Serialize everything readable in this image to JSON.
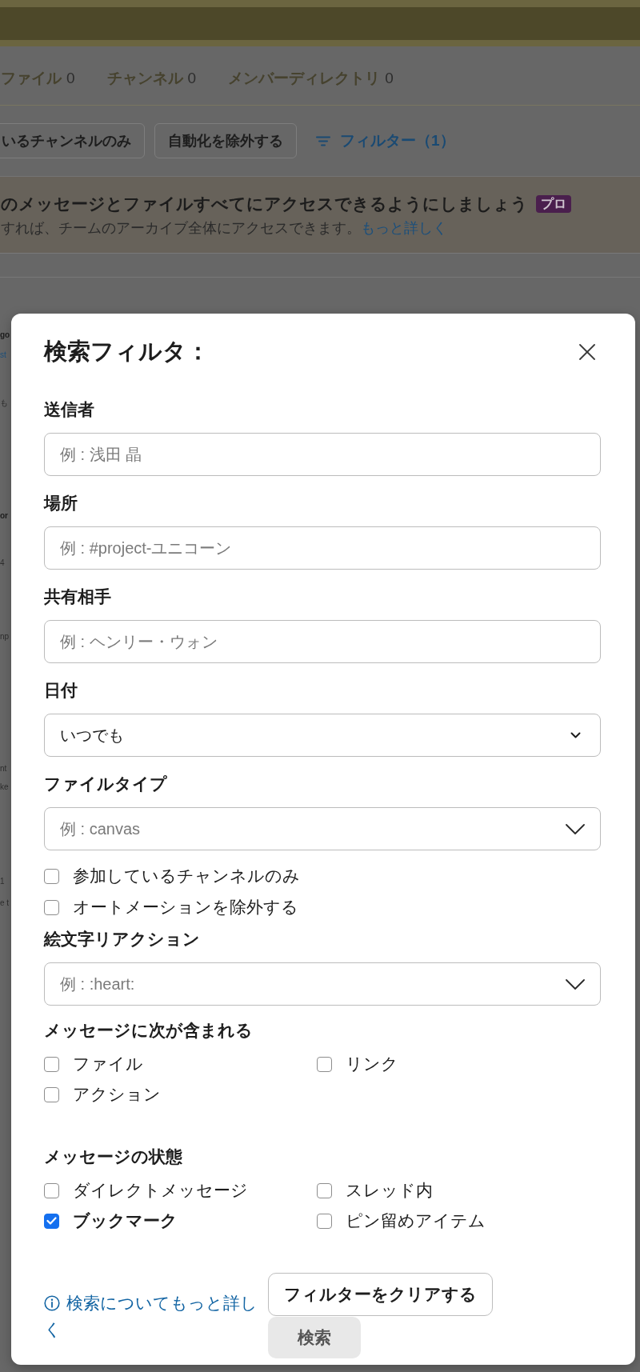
{
  "tabs": [
    {
      "label": "ファイル",
      "count": "0"
    },
    {
      "label": "チャンネル",
      "count": "0"
    },
    {
      "label": "メンバーディレクトリ",
      "count": "0"
    }
  ],
  "filter_chips": [
    "いるチャンネルのみ",
    "自動化を除外する"
  ],
  "filter_link": {
    "label": "フィルター（1）"
  },
  "banner": {
    "title": "のメッセージとファイルすべてにアクセスできるようにしましょう",
    "badge": "プロ",
    "text": "すれば、チームのアーカイブ全体にアクセスできます。",
    "link": "もっと詳しく"
  },
  "edge_fragments": [
    {
      "text": "go",
      "kind": "bold"
    },
    {
      "text": "st",
      "kind": "link"
    },
    {
      "text": "も",
      "kind": "plain"
    },
    {
      "text": "or",
      "kind": "bold"
    },
    {
      "text": "4",
      "kind": "plain"
    },
    {
      "text": "np",
      "kind": "plain"
    },
    {
      "text": "nt",
      "kind": "plain"
    },
    {
      "text": "ke",
      "kind": "plain"
    },
    {
      "text": "1",
      "kind": "plain"
    },
    {
      "text": "e t",
      "kind": "plain"
    }
  ],
  "dialog": {
    "title": "検索フィルタ：",
    "fields": [
      {
        "label": "送信者",
        "kind": "text",
        "placeholder": "例 : 浅田 晶"
      },
      {
        "label": "場所",
        "kind": "text",
        "placeholder": "例 : #project-ユニコーン"
      },
      {
        "label": "共有相手",
        "kind": "text",
        "placeholder": "例 : ヘンリー・ウォン"
      },
      {
        "label": "日付",
        "kind": "select",
        "value": "いつでも"
      },
      {
        "label": "ファイルタイプ",
        "kind": "combobox",
        "placeholder": "例 : canvas"
      }
    ],
    "scope_options": [
      {
        "label": "参加しているチャンネルのみ",
        "checked": false
      },
      {
        "label": "オートメーションを除外する",
        "checked": false
      }
    ],
    "reaction_field": {
      "label": "絵文字リアクション",
      "kind": "combobox",
      "placeholder": "例 : :heart:"
    },
    "groups": [
      {
        "title": "メッセージに次が含まれる",
        "options": [
          {
            "label": "ファイル",
            "checked": false
          },
          {
            "label": "リンク",
            "checked": false
          },
          {
            "label": "アクション",
            "checked": false
          }
        ]
      },
      {
        "title": "メッセージの状態",
        "options": [
          {
            "label": "ダイレクトメッセージ",
            "checked": false
          },
          {
            "label": "スレッド内",
            "checked": false
          },
          {
            "label": "ブックマーク",
            "checked": true
          },
          {
            "label": "ピン留めアイテム",
            "checked": false
          }
        ]
      }
    ],
    "help_link": "検索についてもっと詳しく",
    "buttons": [
      {
        "label": "フィルターをクリアする",
        "kind": "secondary",
        "disabled": false
      },
      {
        "label": "検索",
        "kind": "primary",
        "disabled": true
      }
    ]
  }
}
